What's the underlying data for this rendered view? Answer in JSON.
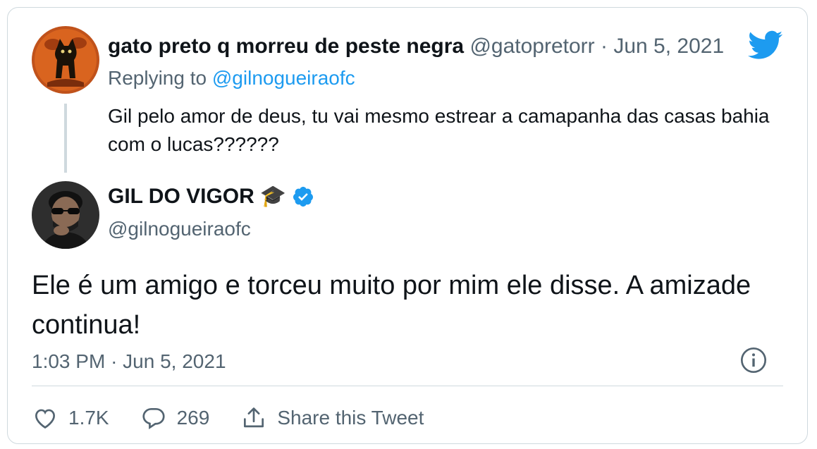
{
  "reply_tweet": {
    "display_name": "gato preto q morreu de peste negra",
    "handle": "@gatopretorr",
    "separator": "·",
    "date": "Jun 5, 2021",
    "replying_label": "Replying to",
    "replying_handle": "@gilnogueiraofc",
    "text": "Gil pelo amor de deus, tu vai mesmo estrear a camapanha das casas bahia com o lucas??????"
  },
  "main_tweet": {
    "display_name": "GIL DO VIGOR",
    "name_emoji": "🎓",
    "handle": "@gilnogueiraofc",
    "text": "Ele é um amigo e torceu muito por mim ele disse. A amizade continua!",
    "time": "1:03 PM",
    "separator": "·",
    "date": "Jun 5, 2021"
  },
  "actions": {
    "likes": "1.7K",
    "replies": "269",
    "share_label": "Share this Tweet"
  },
  "colors": {
    "brand_blue": "#1d9bf0",
    "muted_text": "#536471",
    "border": "#cfd9de"
  },
  "icons": [
    "twitter-bird-icon",
    "verified-badge-icon",
    "info-icon",
    "heart-icon",
    "reply-bubble-icon",
    "share-icon"
  ]
}
